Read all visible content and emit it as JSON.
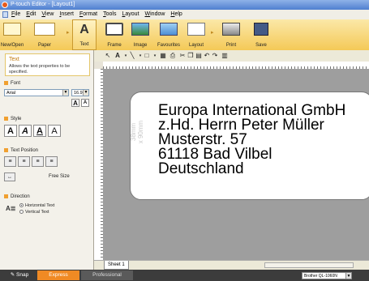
{
  "window": {
    "title": "P-touch Editor - [Layout1]"
  },
  "menu": [
    "File",
    "Edit",
    "View",
    "Insert",
    "Format",
    "Tools",
    "Layout",
    "Window",
    "Help"
  ],
  "ribbon": {
    "new_open": "New/Open",
    "paper": "Paper",
    "text": "Text",
    "frame": "Frame",
    "image": "Image",
    "favourites": "Favourites",
    "layout": "Layout",
    "print": "Print",
    "save": "Save"
  },
  "properties": {
    "heading": "Text",
    "description": "Allows the text properties to be specified.",
    "font_section": "Font",
    "font_name": "Arial",
    "font_size": "16.9",
    "grow_label": "A",
    "shrink_label": "A",
    "style_section": "Style",
    "style_buttons": [
      "A",
      "A",
      "A",
      "A"
    ],
    "position_section": "Text Position",
    "free_size": "Free Size",
    "direction_section": "Direction",
    "direction_options": [
      "Horizontal Text",
      "Vertical Text"
    ]
  },
  "label": {
    "dimensions": "38mm\nx 90mm",
    "text": "Europa International GmbH\nz.Hd. Herrn Peter Müller\nMusterstr. 57\n61118 Bad Vilbel\nDeutschland"
  },
  "sheet": {
    "tab": "Sheet 1"
  },
  "status": {
    "snap": "Snap",
    "modes": [
      "Express",
      "Professional"
    ],
    "printer": "Brother QL-1060N"
  },
  "colors": {
    "ribbon": "#f4c957",
    "accent": "#f0a030",
    "express_active": "#f08a24"
  }
}
